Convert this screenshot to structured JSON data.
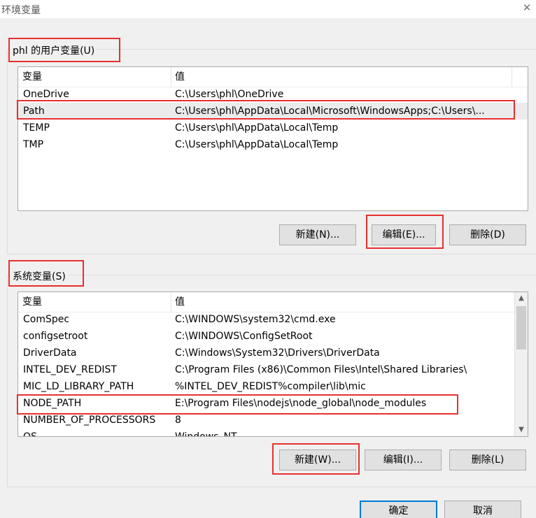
{
  "window": {
    "title": "环境变量"
  },
  "user_vars": {
    "label": "phl 的用户变量(U)",
    "columns": {
      "name": "变量",
      "value": "值"
    },
    "rows": [
      {
        "name": "OneDrive",
        "value": "C:\\Users\\phl\\OneDrive"
      },
      {
        "name": "Path",
        "value": "C:\\Users\\phl\\AppData\\Local\\Microsoft\\WindowsApps;C:\\Users\\..."
      },
      {
        "name": "TEMP",
        "value": "C:\\Users\\phl\\AppData\\Local\\Temp"
      },
      {
        "name": "TMP",
        "value": "C:\\Users\\phl\\AppData\\Local\\Temp"
      }
    ],
    "buttons": {
      "new": "新建(N)...",
      "edit": "编辑(E)...",
      "delete": "删除(D)"
    }
  },
  "system_vars": {
    "label": "系统变量(S)",
    "columns": {
      "name": "变量",
      "value": "值"
    },
    "rows": [
      {
        "name": "ComSpec",
        "value": "C:\\WINDOWS\\system32\\cmd.exe"
      },
      {
        "name": "configsetroot",
        "value": "C:\\WINDOWS\\ConfigSetRoot"
      },
      {
        "name": "DriverData",
        "value": "C:\\Windows\\System32\\Drivers\\DriverData"
      },
      {
        "name": "INTEL_DEV_REDIST",
        "value": "C:\\Program Files (x86)\\Common Files\\Intel\\Shared Libraries\\"
      },
      {
        "name": "MIC_LD_LIBRARY_PATH",
        "value": "%INTEL_DEV_REDIST%compiler\\lib\\mic"
      },
      {
        "name": "NODE_PATH",
        "value": "E:\\Program Files\\nodejs\\node_global\\node_modules"
      },
      {
        "name": "NUMBER_OF_PROCESSORS",
        "value": "8"
      },
      {
        "name": "OS",
        "value": "Windows_NT"
      }
    ],
    "buttons": {
      "new": "新建(W)...",
      "edit": "编辑(I)...",
      "delete": "删除(L)"
    }
  },
  "footer": {
    "ok": "确定",
    "cancel": "取消"
  },
  "colors": {
    "highlight_box": "#e8302e",
    "selected_row": "#ebebeb",
    "button_face": "#e1e1e1"
  },
  "icons": {
    "close": "close-icon",
    "scroll_up": "chevron-up-icon",
    "scroll_down": "chevron-down-icon"
  }
}
